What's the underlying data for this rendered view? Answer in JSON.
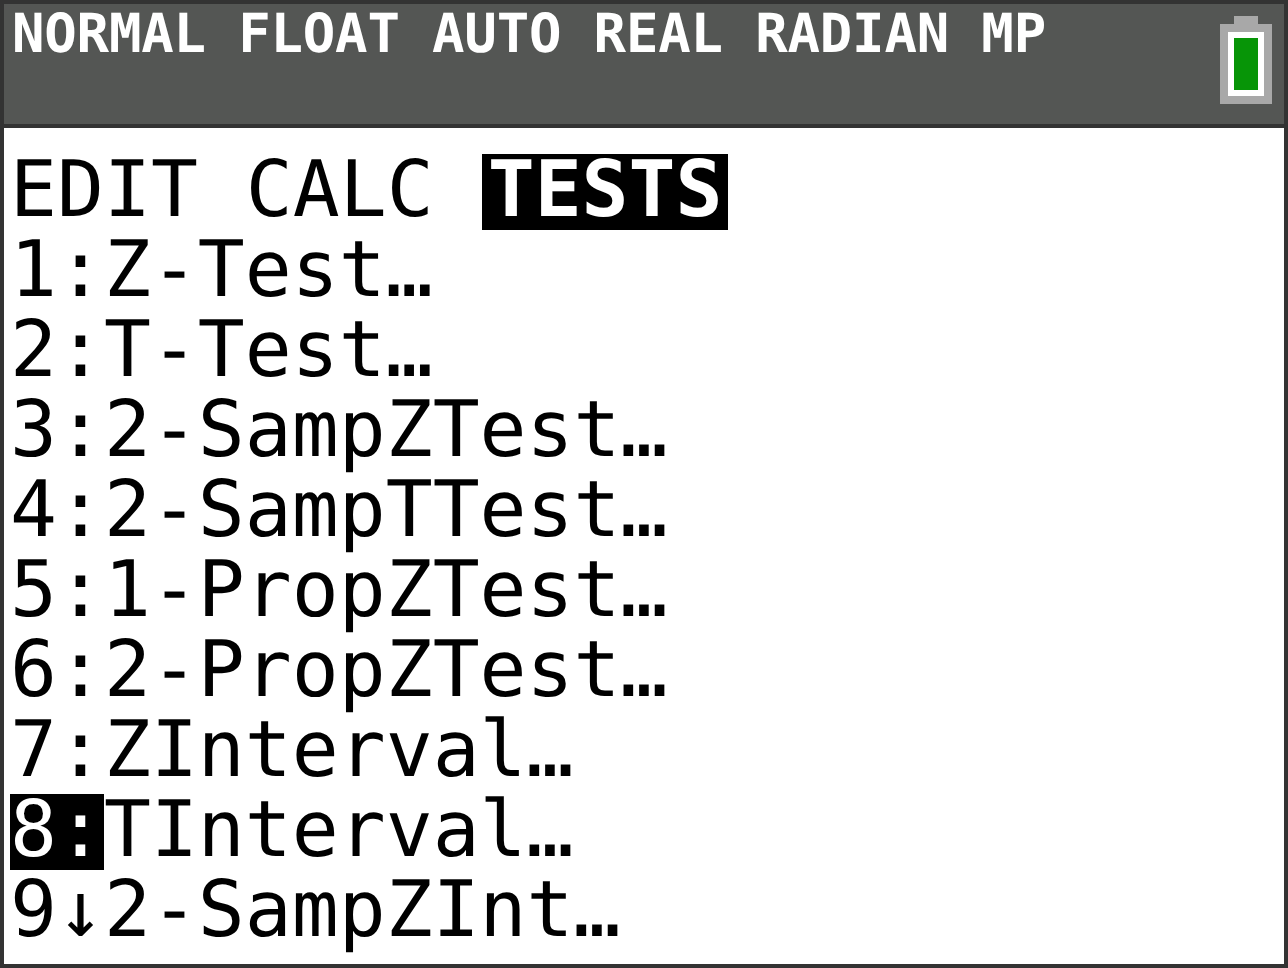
{
  "status_bar": {
    "modes": "NORMAL FLOAT AUTO REAL RADIAN MP"
  },
  "tabs": [
    {
      "label": "EDIT",
      "selected": false
    },
    {
      "label": "CALC",
      "selected": false
    },
    {
      "label": "TESTS",
      "selected": true
    }
  ],
  "menu_items": [
    {
      "key": "1",
      "separator": ":",
      "label": "Z-Test…",
      "selected": false
    },
    {
      "key": "2",
      "separator": ":",
      "label": "T-Test…",
      "selected": false
    },
    {
      "key": "3",
      "separator": ":",
      "label": "2-SampZTest…",
      "selected": false
    },
    {
      "key": "4",
      "separator": ":",
      "label": "2-SampTTest…",
      "selected": false
    },
    {
      "key": "5",
      "separator": ":",
      "label": "1-PropZTest…",
      "selected": false
    },
    {
      "key": "6",
      "separator": ":",
      "label": "2-PropZTest…",
      "selected": false
    },
    {
      "key": "7",
      "separator": ":",
      "label": "ZInterval…",
      "selected": false
    },
    {
      "key": "8",
      "separator": ":",
      "label": "TInterval…",
      "selected": true
    },
    {
      "key": "9",
      "separator": "↓",
      "label": "2-SampZInt…",
      "selected": false
    }
  ]
}
